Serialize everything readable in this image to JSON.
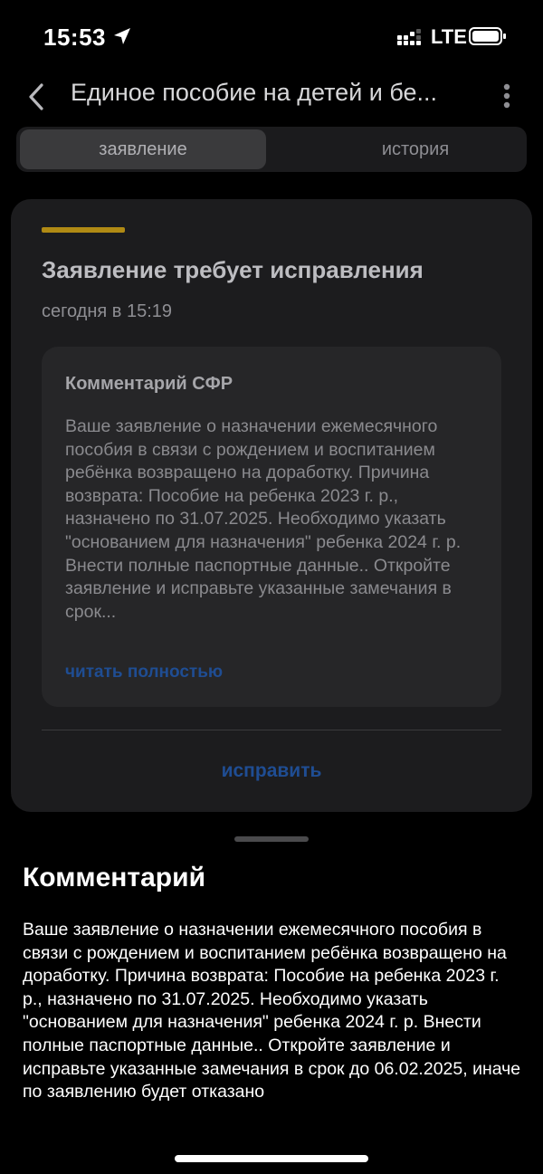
{
  "status_bar": {
    "time": "15:53",
    "network": "LTE"
  },
  "header": {
    "title": "Единое пособие на детей и бе..."
  },
  "tabs": [
    {
      "label": "заявление",
      "active": true
    },
    {
      "label": "история",
      "active": false
    }
  ],
  "card": {
    "accent_color": "#b08a14",
    "heading": "Заявление требует исправления",
    "date": "сегодня в 15:19",
    "comment": {
      "title": "Комментарий СФР",
      "text": "Ваше заявление о назначении ежемесячного пособия в связи с рождением и воспитанием ребёнка возвращено на доработку. Причина возврата: Пособие на ребенка 2023 г. р., назначено по 31.07.2025. Необходимо указать \"основанием для назначения\" ребенка 2024 г. р. Внести полные паспортные данные.. Откройте заявление и исправьте указанные замечания в срок...",
      "read_more": "читать полностью"
    },
    "action": "исправить"
  },
  "sheet": {
    "title": "Комментарий",
    "text": "Ваше заявление о назначении ежемесячного пособия в связи с рождением и воспитанием ребёнка возвращено на доработку. Причина возврата: Пособие на ребенка 2023 г. р., назначено по 31.07.2025. Необходимо указать \"основанием для назначения\" ребенка 2024 г. р. Внести полные паспортные данные.. Откройте заявление и исправьте указанные замечания в срок до 06.02.2025, иначе по заявлению будет отказано"
  },
  "icons": {
    "location": "location-arrow-icon",
    "signal": "signal-icon",
    "battery": "battery-icon",
    "back": "back-chevron-icon",
    "more": "more-vertical-icon"
  },
  "colors": {
    "background": "#000000",
    "card": "#1c1c1e",
    "link": "#1f4d93"
  }
}
